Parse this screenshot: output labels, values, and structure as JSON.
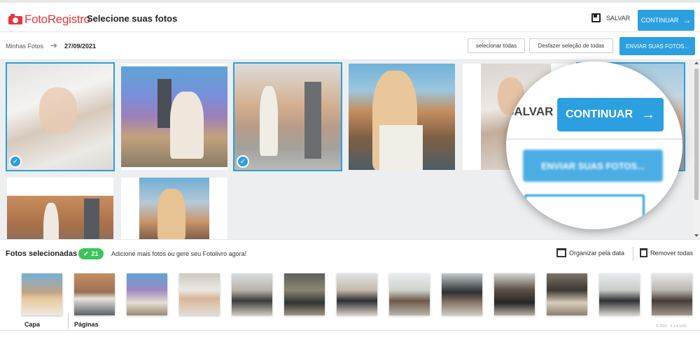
{
  "header": {
    "logo_text": "FotoRegistro",
    "title": "Selecione suas fotos",
    "save_label": "SALVAR",
    "continue_label": "CONTINUAR",
    "continue_arrow": "→"
  },
  "subbar": {
    "breadcrumb_root": "Minhas Fotos",
    "breadcrumb_arrow": "➔",
    "breadcrumb_date": "27/09/2021",
    "select_all_label": "selecionar todas",
    "undo_label": "Desfazer seleção de todas",
    "upload_label": "ENVIAR SUAS FOTOS..."
  },
  "gallery": {
    "check_glyph": "✓",
    "photos": [
      {
        "name": "photo-1",
        "selected": true
      },
      {
        "name": "photo-2",
        "selected": false
      },
      {
        "name": "photo-3",
        "selected": true
      },
      {
        "name": "photo-4",
        "selected": false
      },
      {
        "name": "photo-5",
        "selected": false
      },
      {
        "name": "photo-6",
        "selected": true
      },
      {
        "name": "photo-7",
        "selected": false
      },
      {
        "name": "photo-8",
        "selected": false
      }
    ]
  },
  "zoom": {
    "salvar": "SALVAR",
    "continue_label": "CONTINUAR",
    "continue_arrow": "→",
    "upload_label": "ENVIAR SUAS FOTOS..."
  },
  "selection": {
    "title": "Fotos selecionadas",
    "count": "21",
    "count_check": "✔",
    "message": "Adicione mais fotos ou gere seu Fotolivro agora!",
    "organize_label": "Organizar pela data",
    "remove_label": "Remover todas"
  },
  "strip": {
    "cover_label": "Capa",
    "pages_label": "Páginas",
    "version": "© 2021 - 9.1.4.1001"
  },
  "colors": {
    "accent": "#2c9fe0",
    "brand": "#e8353b",
    "badge": "#3cc45c"
  }
}
